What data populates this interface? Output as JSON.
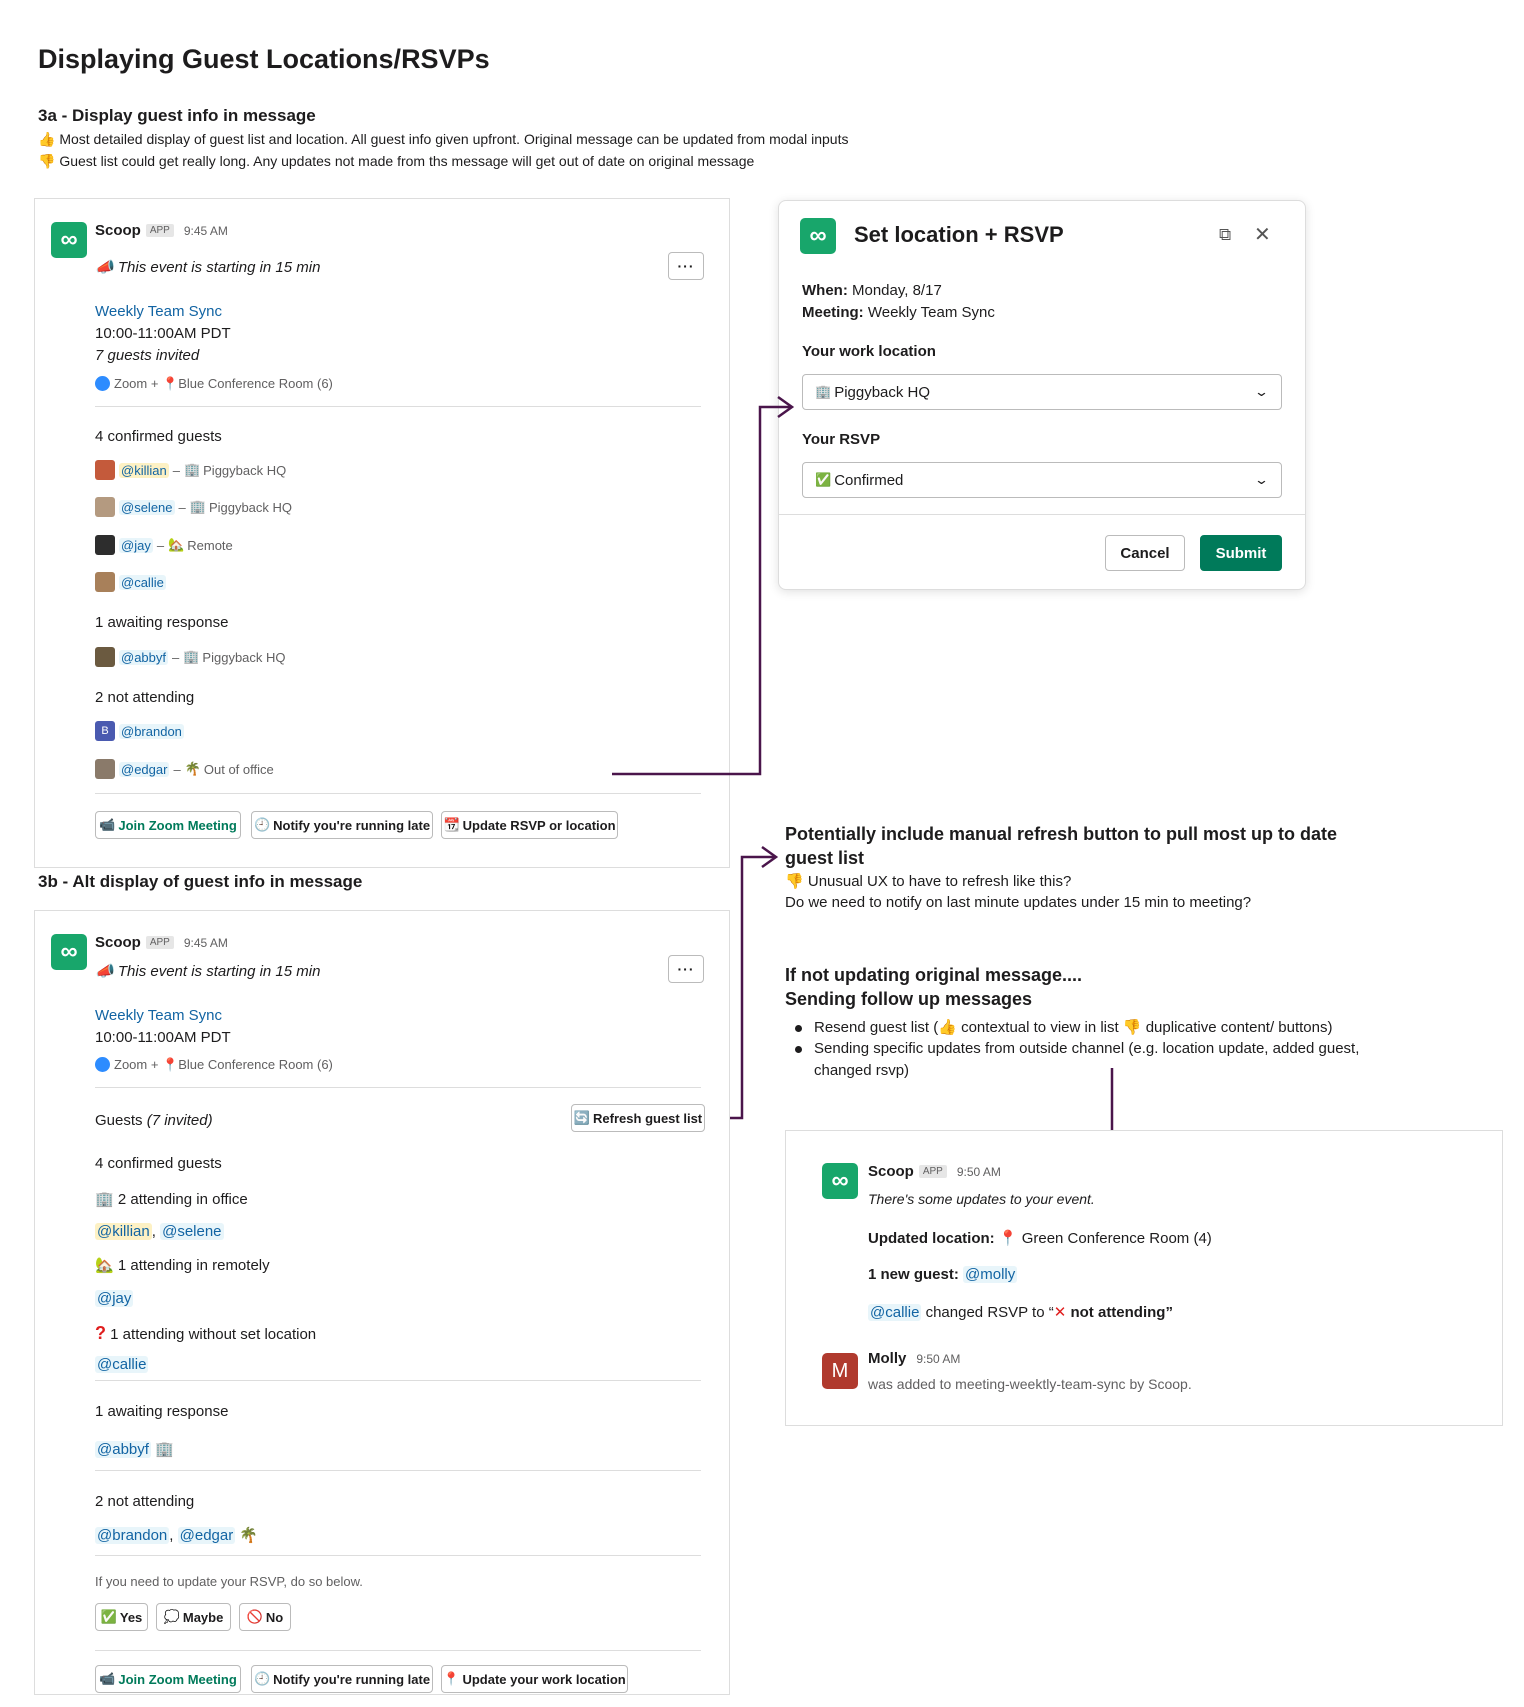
{
  "page": {
    "title": "Displaying Guest Locations/RSVPs",
    "section_3a": {
      "title": "3a - Display guest  info in message",
      "pro": "Most detailed display of guest list and location. All guest info given upfront. Original message can be updated from modal inputs",
      "con": "Guest list could get really long. Any updates not made from ths message will get out of date on original message"
    },
    "section_3b": {
      "title": "3b - Alt display of guest info in message"
    }
  },
  "msg_a": {
    "sender": "Scoop",
    "badge": "APP",
    "time": "9:45 AM",
    "intro": "This event is starting in 15 min",
    "event_title": "Weekly Team Sync",
    "event_time": "10:00-11:00AM PDT",
    "guests_invited": "7 guests invited",
    "zoom": "Zoom +",
    "room": "Blue Conference Room (6)",
    "confirmed_header": "4 confirmed guests",
    "confirmed": [
      {
        "handle": "@killian",
        "location": "Piggyback HQ",
        "loc_icon": "office-icon",
        "color": "#c45a3b"
      },
      {
        "handle": "@selene",
        "location": "Piggyback HQ",
        "loc_icon": "office-icon",
        "color": "#b49a80"
      },
      {
        "handle": "@jay",
        "location": "Remote",
        "loc_icon": "house-icon",
        "color": "#2d2d2d"
      },
      {
        "handle": "@callie",
        "location": "",
        "loc_icon": "",
        "color": "#a8805a"
      }
    ],
    "awaiting_header": "1 awaiting response",
    "awaiting": [
      {
        "handle": "@abbyf",
        "location": "Piggyback HQ",
        "loc_icon": "office-icon",
        "color": "#6b5a40"
      }
    ],
    "not_attending_header": "2 not attending",
    "not_attending": [
      {
        "handle": "@brandon",
        "location": "",
        "loc_icon": "",
        "color": "#4a5ab0",
        "initial": "B"
      },
      {
        "handle": "@edgar",
        "location": "Out of office",
        "loc_icon": "palm-tree-icon",
        "color": "#8a7a6a"
      }
    ],
    "buttons": {
      "join": "Join Zoom Meeting",
      "notify": "Notify you're running late",
      "update": "Update RSVP or location"
    }
  },
  "modal": {
    "title": "Set location + RSVP",
    "when_label": "When:",
    "when_value": "Monday, 8/17",
    "meeting_label": "Meeting:",
    "meeting_value": "Weekly Team Sync",
    "location_label": "Your work location",
    "location_value": "Piggyback HQ",
    "rsvp_label": "Your RSVP",
    "rsvp_value": "Confirmed",
    "cancel": "Cancel",
    "submit": "Submit"
  },
  "note_refresh": {
    "title": "Potentially include manual refresh button to pull most up to date guest list",
    "line1": "Unusual UX to have to refresh like this?",
    "line2": "Do we need to notify on last minute updates under 15 min to meeting?"
  },
  "note_followup": {
    "title1": "If not updating original message....",
    "title2": "Sending follow up messages",
    "bullet1_a": "Resend guest list (",
    "bullet1_b": "contextual to view in list",
    "bullet1_c": "duplicative content/ buttons)",
    "bullet2_a": "Sending specific updates from outside channel (e.g. location update, added guest,",
    "bullet2_b": "changed rsvp)"
  },
  "followup_msg": {
    "sender": "Scoop",
    "badge": "APP",
    "time": "9:50 AM",
    "intro": "There's some updates to your event.",
    "loc_label": "Updated location:",
    "loc_value": "Green Conference Room (4)",
    "guest_label": "1 new guest:",
    "guest_value": "@molly",
    "rsvp_handle": "@callie",
    "rsvp_text": "changed RSVP to “",
    "rsvp_value": "not attending”",
    "molly_name": "Molly",
    "molly_initial": "M",
    "molly_time": "9:50 AM",
    "molly_text": "was added to meeting-weektly-team-sync by Scoop."
  },
  "msg_b": {
    "sender": "Scoop",
    "badge": "APP",
    "time": "9:45 AM",
    "intro": "This event is starting in 15 min",
    "event_title": "Weekly Team Sync",
    "event_time": "10:00-11:00AM PDT",
    "zoom": "Zoom +",
    "room": "Blue Conference Room (6)",
    "guests_label": "Guests",
    "guests_count": "(7 invited)",
    "refresh": "Refresh guest list",
    "confirmed_header": "4 confirmed guests",
    "office_header": "2 attending in office",
    "office_guests": [
      "@killian",
      "@selene"
    ],
    "remote_header": "1 attending in remotely",
    "remote_guests": [
      "@jay"
    ],
    "noloc_header": "1 attending without set location",
    "noloc_guests": [
      "@callie"
    ],
    "awaiting_header": "1 awaiting response",
    "awaiting_guests": [
      "@abbyf"
    ],
    "not_attending_header": "2 not attending",
    "not_attending_guests": [
      "@brandon",
      "@edgar"
    ],
    "rsvp_prompt": "If you need to update your RSVP, do so below.",
    "rsvp_yes": "Yes",
    "rsvp_maybe": "Maybe",
    "rsvp_no": "No",
    "buttons": {
      "join": "Join Zoom Meeting",
      "notify": "Notify you're running late",
      "update": "Update your work location"
    }
  },
  "colors": {
    "brand": "#18a66b",
    "link": "#1264a3",
    "submit": "#007a5a",
    "arrow": "#4a154b",
    "molly": "#b03a2e"
  }
}
